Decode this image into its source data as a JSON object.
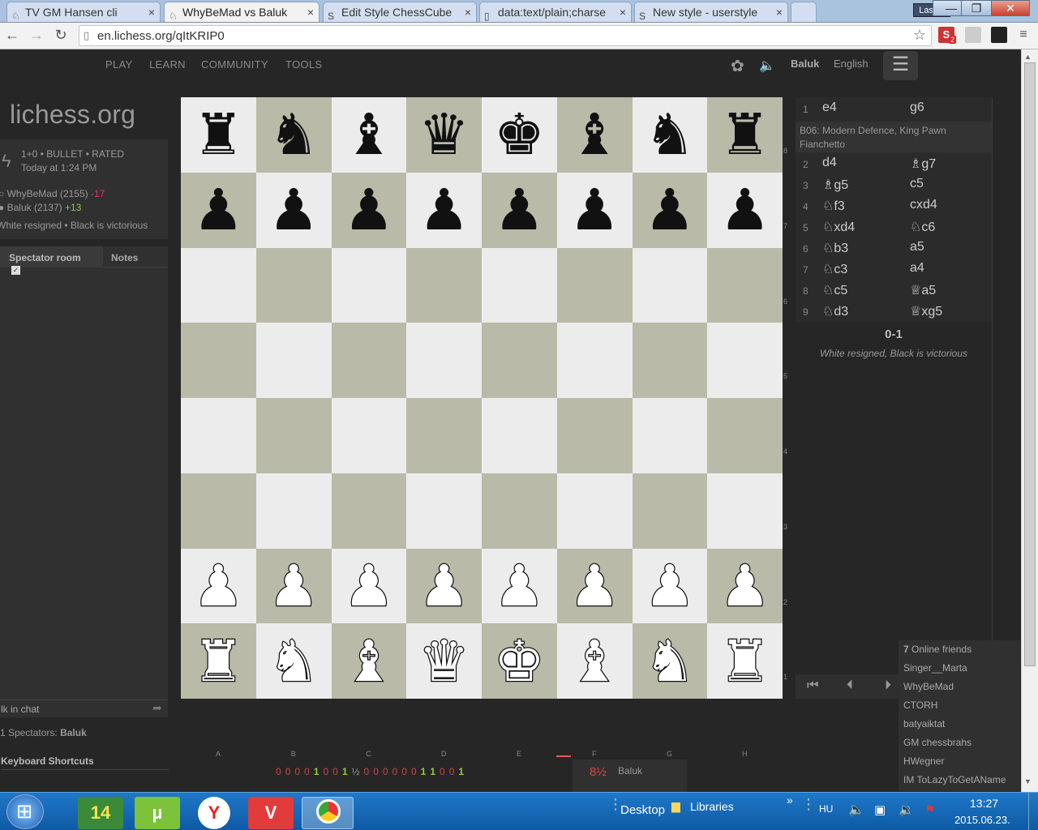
{
  "browser": {
    "tabs": [
      {
        "label": "TV GM Hansen cli",
        "active": false,
        "icon": "lichess-icon"
      },
      {
        "label": "WhyBeMad vs Baluk",
        "active": true,
        "icon": "lichess-icon"
      },
      {
        "label": "Edit Style ChessCube",
        "active": false,
        "icon": "stylish-icon"
      },
      {
        "label": "data:text/plain;charse",
        "active": false,
        "icon": "page-icon"
      },
      {
        "label": "New style - userstyle",
        "active": false,
        "icon": "stylish-icon"
      }
    ],
    "user": "Laszlo",
    "url": "en.lichess.org/qItKRIP0",
    "extension_badge": "2"
  },
  "site": {
    "nav": [
      "PLAY",
      "LEARN",
      "COMMUNITY",
      "TOOLS"
    ],
    "username": "Baluk",
    "language": "English",
    "logo": "lichess.org"
  },
  "game": {
    "mode": "1+0 • BULLET • RATED",
    "time": "Today at 1:24 PM",
    "white_player": "WhyBeMad (2155)",
    "white_diff": "-17",
    "black_player": "Baluk (2137)",
    "black_diff": "+13",
    "result_text": "White resigned • Black is victorious"
  },
  "chat": {
    "tab_spectator": "Spectator room",
    "tab_notes": "Notes",
    "input_placeholder": "lk in chat",
    "spectators_label": "1 Spectators:",
    "spectators_name": "Baluk",
    "keyboard_shortcuts": "Keyboard Shortcuts"
  },
  "board": {
    "files": [
      "A",
      "B",
      "C",
      "D",
      "E",
      "F",
      "G",
      "H"
    ],
    "ranks": [
      "8",
      "7",
      "6",
      "5",
      "4",
      "3",
      "2",
      "1"
    ],
    "position": [
      [
        "br",
        "bn",
        "bb",
        "bq",
        "bk",
        "bb",
        "bn",
        "br"
      ],
      [
        "bp",
        "bp",
        "bp",
        "bp",
        "bp",
        "bp",
        "bp",
        "bp"
      ],
      [
        "",
        "",
        "",
        "",
        "",
        "",
        "",
        ""
      ],
      [
        "",
        "",
        "",
        "",
        "",
        "",
        "",
        ""
      ],
      [
        "",
        "",
        "",
        "",
        "",
        "",
        "",
        ""
      ],
      [
        "",
        "",
        "",
        "",
        "",
        "",
        "",
        ""
      ],
      [
        "wp",
        "wp",
        "wp",
        "wp",
        "wp",
        "wp",
        "wp",
        "wp"
      ],
      [
        "wr",
        "wn",
        "wb",
        "wq",
        "wk",
        "wb",
        "wn",
        "wr"
      ]
    ]
  },
  "moves": {
    "first": {
      "num": "1",
      "white": "e4",
      "black": "g6"
    },
    "opening": "B06: Modern Defence, King Pawn Fianchetto",
    "list": [
      {
        "num": "2",
        "white": "d4",
        "black": "♗g7"
      },
      {
        "num": "3",
        "white": "♗g5",
        "black": "c5"
      },
      {
        "num": "4",
        "white": "♘f3",
        "black": "cxd4"
      },
      {
        "num": "5",
        "white": "♘xd4",
        "black": "♘c6"
      },
      {
        "num": "6",
        "white": "♘b3",
        "black": "a5"
      },
      {
        "num": "7",
        "white": "♘c3",
        "black": "a4"
      },
      {
        "num": "8",
        "white": "♘c5",
        "black": "♕a5"
      },
      {
        "num": "9",
        "white": "♘d3",
        "black": "♕xg5"
      }
    ],
    "score": "0-1",
    "result": "White resigned, Black is victorious"
  },
  "crosstable": {
    "results": [
      "0",
      "0",
      "0",
      "0",
      "1",
      "0",
      "0",
      "1",
      "½",
      "0",
      "0",
      "0",
      "0",
      "0",
      "0",
      "1",
      "1",
      "0",
      "0",
      "1"
    ],
    "total": "8½",
    "player": "Baluk"
  },
  "friends": {
    "header_count": "7",
    "header_label": "Online friends",
    "list": [
      "Singer__Marta",
      "WhyBeMad",
      "CTORH",
      "batyaiktat",
      "GM chessbrahs",
      "HWegner",
      "IM ToLazyToGetAName"
    ]
  },
  "taskbar": {
    "apps": [
      "14",
      "µ",
      "Y",
      "V",
      ""
    ],
    "desktop": "Desktop",
    "libraries": "Libraries",
    "lang": "HU",
    "time": "13:27",
    "date": "2015.06.23."
  }
}
